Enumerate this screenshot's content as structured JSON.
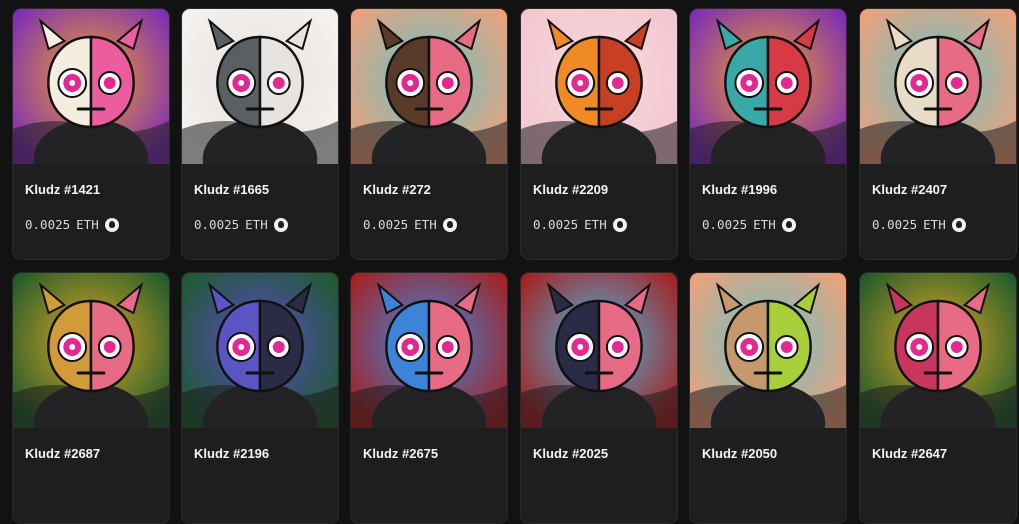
{
  "nfts": [
    {
      "name": "Kludz #1421",
      "price": "0.0025",
      "currency": "ETH",
      "bg": "#7a2bb8",
      "bg2": "#f2a12a",
      "face": "#f5eee0",
      "half": "#ec5d9d",
      "chain_icon": "chain-icon"
    },
    {
      "name": "Kludz #1665",
      "price": "0.0025",
      "currency": "ETH",
      "bg": "#f5f2ef",
      "bg2": "#e7e2de",
      "face": "#5b5f64",
      "half": "#e6e3e0",
      "chain_icon": "chain-icon"
    },
    {
      "name": "Kludz #272",
      "price": "0.0025",
      "currency": "ETH",
      "bg": "#f0a07a",
      "bg2": "#68c3c5",
      "face": "#5a3b2a",
      "half": "#e86b85",
      "chain_icon": "chain-icon"
    },
    {
      "name": "Kludz #2209",
      "price": "0.0025",
      "currency": "ETH",
      "bg": "#f4c6cf",
      "bg2": "#f7d8de",
      "face": "#f08a24",
      "half": "#c84024",
      "chain_icon": "chain-icon"
    },
    {
      "name": "Kludz #1996",
      "price": "0.0025",
      "currency": "ETH",
      "bg": "#7a2bb8",
      "bg2": "#f2a12a",
      "face": "#38a9a6",
      "half": "#d83a45",
      "chain_icon": "chain-icon"
    },
    {
      "name": "Kludz #2407",
      "price": "0.0025",
      "currency": "ETH",
      "bg": "#f0a07a",
      "bg2": "#68c3c5",
      "face": "#e8dcc8",
      "half": "#e86b85",
      "chain_icon": "chain-icon"
    },
    {
      "name": "Kludz #2687",
      "price": "",
      "currency": "",
      "bg": "#1e5a2c",
      "bg2": "#e0a823",
      "face": "#d39a3a",
      "half": "#e86b85",
      "chain_icon": "chain-icon"
    },
    {
      "name": "Kludz #2196",
      "price": "",
      "currency": "",
      "bg": "#1e5a2c",
      "bg2": "#5a4ac6",
      "face": "#5b55c4",
      "half": "#2b2b45",
      "chain_icon": "chain-icon"
    },
    {
      "name": "Kludz #2675",
      "price": "",
      "currency": "",
      "bg": "#a61f1f",
      "bg2": "#3a8be0",
      "face": "#3d84d8",
      "half": "#e86b85",
      "chain_icon": "chain-icon"
    },
    {
      "name": "Kludz #2025",
      "price": "",
      "currency": "",
      "bg": "#a61f1f",
      "bg2": "#4ab8e0",
      "face": "#2b2b45",
      "half": "#e86b85",
      "chain_icon": "chain-icon"
    },
    {
      "name": "Kludz #2050",
      "price": "",
      "currency": "",
      "bg": "#f0a07a",
      "bg2": "#68c3c5",
      "face": "#c49a6c",
      "half": "#a7cf3a",
      "chain_icon": "chain-icon"
    },
    {
      "name": "Kludz #2647",
      "price": "",
      "currency": "",
      "bg": "#1e5a2c",
      "bg2": "#e0a823",
      "face": "#c8365e",
      "half": "#e86b85",
      "chain_icon": "chain-icon"
    }
  ]
}
